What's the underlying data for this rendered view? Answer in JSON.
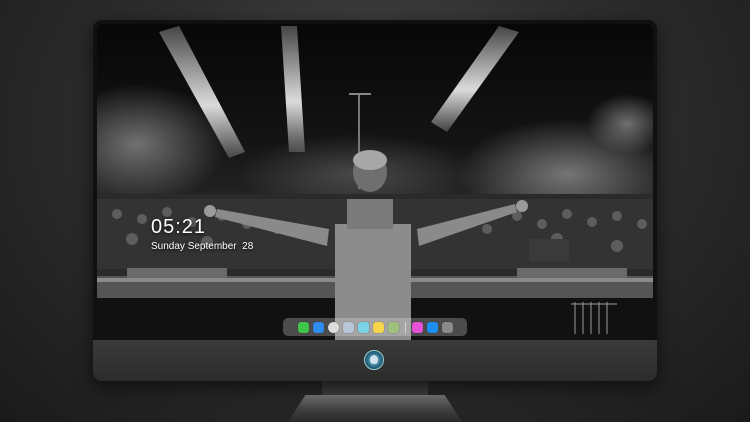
{
  "lock_screen": {
    "time": "05:21",
    "date": "Sunday September  28"
  },
  "dock": {
    "apps": [
      {
        "icon": "messages-icon",
        "color": "#3ec54a"
      },
      {
        "icon": "mail-icon",
        "color": "#2e8cf0"
      },
      {
        "icon": "safari-icon",
        "color": "#dcdcdc"
      },
      {
        "icon": "photos-icon",
        "color": "#b7c6d9"
      },
      {
        "icon": "finalcut-icon",
        "color": "#7cd3e6"
      },
      {
        "icon": "notes-icon",
        "color": "#f7d54a"
      },
      {
        "icon": "preview-icon",
        "color": "#9ec07a"
      },
      {
        "icon": "itunes-icon",
        "color": "#e552d6"
      },
      {
        "icon": "appstore-icon",
        "color": "#1e8ff2"
      },
      {
        "icon": "camera-icon",
        "color": "#8a8a8a"
      }
    ]
  }
}
